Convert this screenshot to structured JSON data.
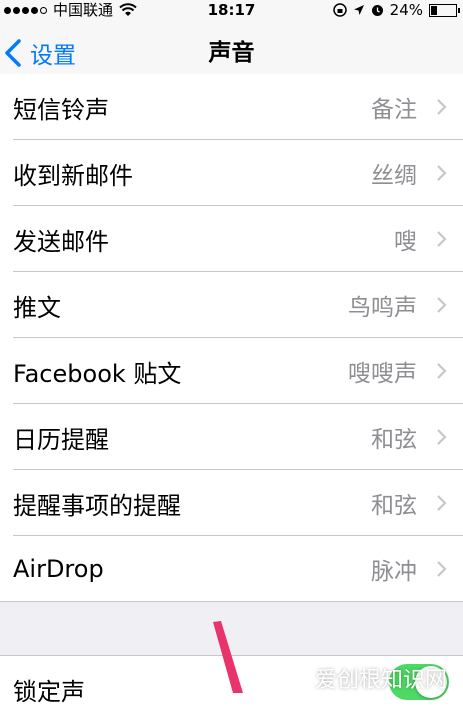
{
  "status_bar": {
    "carrier": "中国联通",
    "time": "18:17",
    "battery": "24%",
    "battery_level": 0.24
  },
  "nav": {
    "back_label": "设置",
    "title": "声音"
  },
  "rows": [
    {
      "label": "短信铃声",
      "value": "备注"
    },
    {
      "label": "收到新邮件",
      "value": "丝绸"
    },
    {
      "label": "发送邮件",
      "value": "嗖"
    },
    {
      "label": "推文",
      "value": "鸟鸣声"
    },
    {
      "label": "Facebook 贴文",
      "value": "嗖嗖声"
    },
    {
      "label": "日历提醒",
      "value": "和弦"
    },
    {
      "label": "提醒事项的提醒",
      "value": "和弦"
    },
    {
      "label": "AirDrop",
      "value": "脉冲"
    }
  ],
  "lock_sound": {
    "label": "锁定声",
    "enabled": true
  },
  "watermark": "爱创根知识网",
  "colors": {
    "accent": "#007aff",
    "toggle_on": "#4cd964",
    "annotation_arrow": "#e8336b"
  }
}
